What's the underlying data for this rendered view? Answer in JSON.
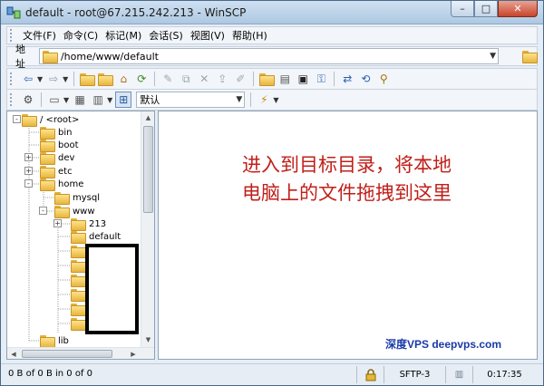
{
  "window": {
    "title": "default - root@67.215.242.213 - WinSCP",
    "controls": {
      "minimize": "–",
      "maximize": "□",
      "close": "✕"
    }
  },
  "menu": {
    "items": [
      "文件(F)",
      "命令(C)",
      "标记(M)",
      "会话(S)",
      "视图(V)",
      "帮助(H)"
    ]
  },
  "address": {
    "label": "地址",
    "path": "/home/www/default"
  },
  "toolbar2": {
    "filter_value": "默认"
  },
  "tree": {
    "items": [
      {
        "label": "/ <root>",
        "expander": "-"
      },
      {
        "label": "bin"
      },
      {
        "label": "boot"
      },
      {
        "label": "dev",
        "expander": "+"
      },
      {
        "label": "etc",
        "expander": "+"
      },
      {
        "label": "home",
        "expander": "-"
      },
      {
        "label": "mysql"
      },
      {
        "label": "www",
        "expander": "-"
      },
      {
        "label": "213",
        "expander": "+"
      },
      {
        "label": "default"
      },
      {
        "label": "lib"
      }
    ]
  },
  "main": {
    "instruction_line1": "进入到目标目录，将本地",
    "instruction_line2": "电脑上的文件拖拽到这里",
    "watermark": "深度VPS deepvps.com"
  },
  "status": {
    "left": "0 B of 0 B in 0 of 0",
    "protocol": "SFTP-3",
    "time": "0:17:35"
  },
  "icons": [
    "app-icon",
    "back-icon",
    "forward-icon",
    "parent-dir-icon",
    "root-dir-icon",
    "home-dir-icon",
    "refresh-icon",
    "edit-icon",
    "copy-icon",
    "delete-icon",
    "move-icon",
    "rename-icon",
    "new-folder-icon",
    "properties-icon",
    "terminal-icon",
    "permissions-icon",
    "sync-icon",
    "find-icon",
    "settings-icon",
    "preferences-icon",
    "tree-view-icon",
    "lock-icon"
  ]
}
